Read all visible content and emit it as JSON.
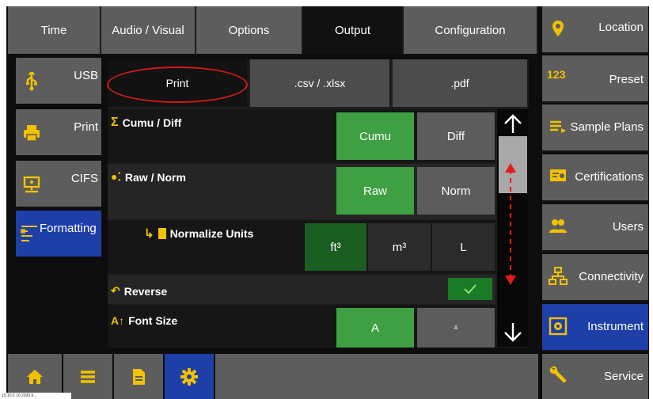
{
  "top_tabs": [
    "Time",
    "Audio / Visual",
    "Options",
    "Output",
    "Configuration"
  ],
  "sidebar": [
    {
      "label": "USB",
      "icon": "usb-icon"
    },
    {
      "label": "Print",
      "icon": "printer-icon"
    },
    {
      "label": "CIFS",
      "icon": "network-share-icon"
    },
    {
      "label": "Formatting",
      "icon": "formatting-icon"
    }
  ],
  "right_menu": [
    {
      "label": "Location",
      "icon": "location-pin-icon"
    },
    {
      "label": "Preset",
      "icon": "preset-123-icon"
    },
    {
      "label": "Sample Plans",
      "icon": "sample-plans-icon"
    },
    {
      "label": "Certifications",
      "icon": "certificate-icon"
    },
    {
      "label": "Users",
      "icon": "users-icon"
    },
    {
      "label": "Connectivity",
      "icon": "connectivity-icon"
    },
    {
      "label": "Instrument",
      "icon": "instrument-icon"
    },
    {
      "label": "Service",
      "icon": "wrench-icon"
    }
  ],
  "sub_tabs": [
    "Print",
    ".csv / .xlsx",
    ".pdf"
  ],
  "rows": {
    "cumu_diff": {
      "label": "Cumu / Diff",
      "options": [
        "Cumu",
        "Diff"
      ],
      "selected": "Cumu"
    },
    "raw_norm": {
      "label": "Raw / Norm",
      "options": [
        "Raw",
        "Norm"
      ],
      "selected": "Raw"
    },
    "normalize_units": {
      "label": "Normalize Units",
      "options": [
        "ft³",
        "m³",
        "L"
      ],
      "selected": "ft³"
    },
    "reverse": {
      "label": "Reverse",
      "checked": true
    },
    "font_size": {
      "label": "Font Size",
      "options": [
        "A",
        "A"
      ],
      "selected_index": 0
    }
  },
  "bottom_nav": [
    "home-icon",
    "list-icon",
    "document-icon",
    "settings-gear-icon"
  ],
  "build_text": "10.10.2 10 2020 b...",
  "colors": {
    "accent_blue": "#1f3fa8",
    "selected_green": "#3ea043",
    "annotation_red": "#d11a1a",
    "tile_gray": "#5d5d5d"
  }
}
